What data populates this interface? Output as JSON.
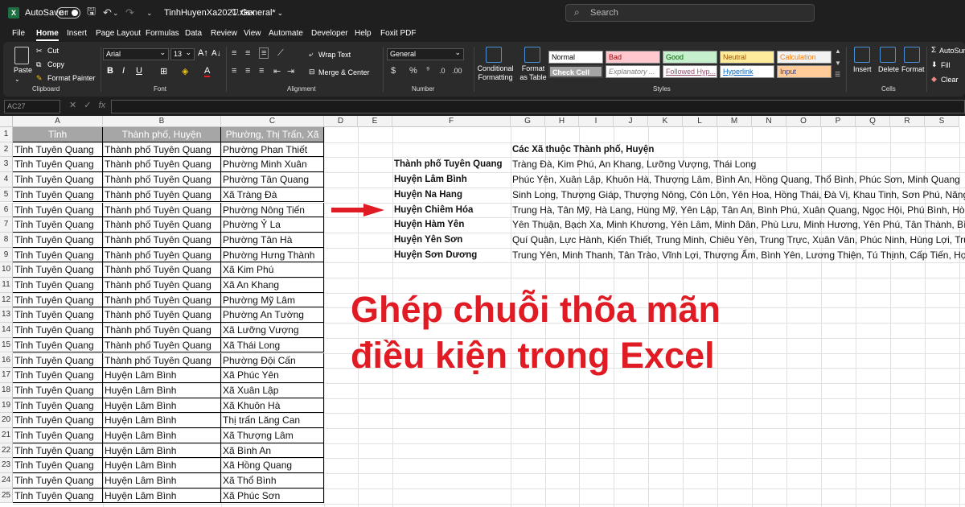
{
  "app": {
    "logo_letter": "X",
    "autosave_label": "AutoSave",
    "autosave_state": "Off",
    "filename": "TinhHuyenXa2021.xlsx",
    "sensitivity": "General*",
    "search_placeholder": "Search"
  },
  "menu": [
    "File",
    "Home",
    "Insert",
    "Page Layout",
    "Formulas",
    "Data",
    "Review",
    "View",
    "Automate",
    "Developer",
    "Help",
    "Foxit PDF"
  ],
  "ribbon": {
    "clipboard": {
      "paste": "Paste",
      "cut": "Cut",
      "copy": "Copy",
      "format_painter": "Format Painter",
      "label": "Clipboard"
    },
    "font": {
      "name": "Arial",
      "size": "13",
      "label": "Font"
    },
    "alignment": {
      "wrap": "Wrap Text",
      "merge": "Merge & Center",
      "label": "Alignment"
    },
    "number": {
      "format": "General",
      "label": "Number"
    },
    "styles": {
      "conditional": "Conditional Formatting",
      "format_table": "Format as Table",
      "label": "Styles",
      "boxes": [
        {
          "text": "Normal",
          "bg": "#ffffff",
          "fg": "#000000"
        },
        {
          "text": "Bad",
          "bg": "#ffc7ce",
          "fg": "#9c0006"
        },
        {
          "text": "Good",
          "bg": "#c6efce",
          "fg": "#006100"
        },
        {
          "text": "Neutral",
          "bg": "#ffeb9c",
          "fg": "#9c5700"
        },
        {
          "text": "Calculation",
          "bg": "#f2f2f2",
          "fg": "#fa7d00"
        },
        {
          "text": "Check Cell",
          "bg": "#a5a5a5",
          "fg": "#ffffff"
        },
        {
          "text": "Explanatory ...",
          "bg": "#ffffff",
          "fg": "#7f7f7f"
        },
        {
          "text": "Followed Hyp...",
          "bg": "#ffffff",
          "fg": "#954f72"
        },
        {
          "text": "Hyperlink",
          "bg": "#ffffff",
          "fg": "#0563c1"
        },
        {
          "text": "Input",
          "bg": "#ffcc99",
          "fg": "#3f3f76"
        }
      ]
    },
    "cells": {
      "insert": "Insert",
      "delete": "Delete",
      "format": "Format",
      "label": "Cells"
    },
    "editing": {
      "autosum": "AutoSum",
      "fill": "Fill",
      "clear": "Clear"
    }
  },
  "formula_bar": {
    "name_box": "AC27",
    "fx": "fx",
    "formula": ""
  },
  "columns": [
    "A",
    "B",
    "C",
    "D",
    "E",
    "F",
    "G",
    "H",
    "I",
    "J",
    "K",
    "L",
    "M",
    "N",
    "O",
    "P",
    "Q",
    "R",
    "S"
  ],
  "row_numbers": [
    "1",
    "2",
    "3",
    "4",
    "5",
    "6",
    "7",
    "8",
    "9",
    "10",
    "11",
    "12",
    "13",
    "14",
    "15",
    "16",
    "17",
    "18",
    "19",
    "20",
    "21",
    "22",
    "23",
    "24",
    "25"
  ],
  "table_headers": [
    "Tỉnh",
    "Thành phố, Huyện",
    "Phường, Thị Trấn, Xã"
  ],
  "table_rows": [
    [
      "Tỉnh Tuyên Quang",
      "Thành phố Tuyên Quang",
      "Phường Phan Thiết"
    ],
    [
      "Tỉnh Tuyên Quang",
      "Thành phố Tuyên Quang",
      "Phường Minh Xuân"
    ],
    [
      "Tỉnh Tuyên Quang",
      "Thành phố Tuyên Quang",
      "Phường Tân Quang"
    ],
    [
      "Tỉnh Tuyên Quang",
      "Thành phố Tuyên Quang",
      "Xã Tràng Đà"
    ],
    [
      "Tỉnh Tuyên Quang",
      "Thành phố Tuyên Quang",
      "Phường Nông Tiến"
    ],
    [
      "Tỉnh Tuyên Quang",
      "Thành phố Tuyên Quang",
      "Phường Ỷ La"
    ],
    [
      "Tỉnh Tuyên Quang",
      "Thành phố Tuyên Quang",
      "Phường Tân Hà"
    ],
    [
      "Tỉnh Tuyên Quang",
      "Thành phố Tuyên Quang",
      "Phường Hưng Thành"
    ],
    [
      "Tỉnh Tuyên Quang",
      "Thành phố Tuyên Quang",
      "Xã Kim Phú"
    ],
    [
      "Tỉnh Tuyên Quang",
      "Thành phố Tuyên Quang",
      "Xã An Khang"
    ],
    [
      "Tỉnh Tuyên Quang",
      "Thành phố Tuyên Quang",
      "Phường Mỹ Lâm"
    ],
    [
      "Tỉnh Tuyên Quang",
      "Thành phố Tuyên Quang",
      "Phường An Tường"
    ],
    [
      "Tỉnh Tuyên Quang",
      "Thành phố Tuyên Quang",
      "Xã Lưỡng Vượng"
    ],
    [
      "Tỉnh Tuyên Quang",
      "Thành phố Tuyên Quang",
      "Xã Thái Long"
    ],
    [
      "Tỉnh Tuyên Quang",
      "Thành phố Tuyên Quang",
      "Phường Đội Cấn"
    ],
    [
      "Tỉnh Tuyên Quang",
      "Huyện Lâm Bình",
      "Xã Phúc Yên"
    ],
    [
      "Tỉnh Tuyên Quang",
      "Huyện Lâm Bình",
      "Xã Xuân Lập"
    ],
    [
      "Tỉnh Tuyên Quang",
      "Huyện Lâm Bình",
      "Xã Khuôn Hà"
    ],
    [
      "Tỉnh Tuyên Quang",
      "Huyện Lâm Bình",
      "Thị trấn Lăng Can"
    ],
    [
      "Tỉnh Tuyên Quang",
      "Huyện Lâm Bình",
      "Xã Thượng Lâm"
    ],
    [
      "Tỉnh Tuyên Quang",
      "Huyện Lâm Bình",
      "Xã Bình An"
    ],
    [
      "Tỉnh Tuyên Quang",
      "Huyện Lâm Bình",
      "Xã Hồng Quang"
    ],
    [
      "Tỉnh Tuyên Quang",
      "Huyện Lâm Bình",
      "Xã Thổ Bình"
    ],
    [
      "Tỉnh Tuyên Quang",
      "Huyện Lâm Bình",
      "Xã Phúc Sơn"
    ]
  ],
  "summary": {
    "title": "Các Xã thuộc Thành phố, Huyện",
    "rows": [
      [
        "Thành phố Tuyên Quang",
        "Tràng Đà, Kim Phú, An Khang, Lưỡng Vượng, Thái Long"
      ],
      [
        "Huyện Lâm Bình",
        "Phúc Yên, Xuân Lập, Khuôn Hà, Thượng Lâm, Bình An, Hồng Quang, Thổ Bình, Phúc Sơn, Minh Quang"
      ],
      [
        "Huyện Na Hang",
        "Sinh Long, Thượng Giáp, Thượng Nông, Côn Lôn, Yên Hoa, Hồng Thái, Đà Vị, Khau Tinh, Sơn Phú, Năng Khả, Tha"
      ],
      [
        "Huyện Chiêm Hóa",
        "Trung Hà, Tân Mỹ, Hà Lang, Hùng Mỹ, Yên Lập, Tân An, Bình Phú, Xuân Quang, Ngọc Hội, Phú Bình, Hòa Phú, Ph"
      ],
      [
        "Huyện Hàm Yên",
        "Yên Thuận, Bạch Xa, Minh Khương, Yên Lâm, Minh Dân, Phù Lưu, Minh Hương, Yên Phú, Tân Thành, Bình Xa, Th"
      ],
      [
        "Huyện Yên Sơn",
        "Quí Quân, Lực Hành, Kiến Thiết, Trung Minh, Chiêu Yên, Trung Trực, Xuân Vân, Phúc Ninh, Hùng Lợi, Trung Sơn, T"
      ],
      [
        "Huyện Sơn Dương",
        "Trung Yên, Minh Thanh, Tân Trào, Vĩnh Lợi, Thượng Ấm, Bình Yên, Lương Thiện, Tú Thịnh, Cấp Tiến, Hợp Thành, P"
      ]
    ]
  },
  "overlay": {
    "line1": "Ghép chuỗi thõa mãn",
    "line2": "điều kiện trong Excel",
    "color": "#e01b24"
  }
}
